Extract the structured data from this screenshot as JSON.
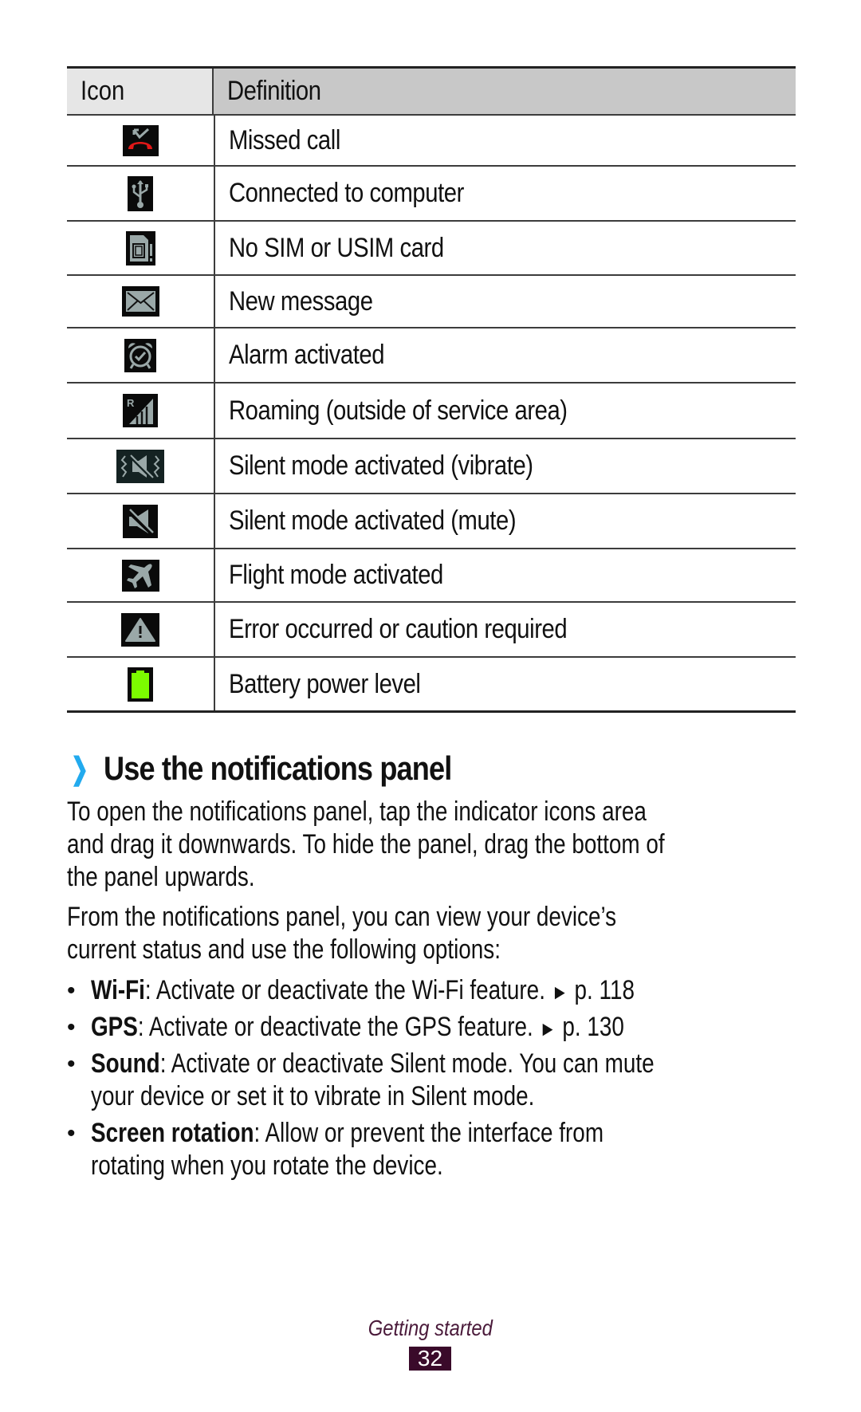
{
  "table": {
    "headers": {
      "icon": "Icon",
      "definition": "Definition"
    },
    "rows": [
      {
        "icon": "missed-call-icon",
        "definition": "Missed call"
      },
      {
        "icon": "usb-icon",
        "definition": "Connected to computer"
      },
      {
        "icon": "no-sim-icon",
        "definition": "No SIM or USIM card"
      },
      {
        "icon": "envelope-icon",
        "definition": "New message"
      },
      {
        "icon": "alarm-clock-icon",
        "definition": "Alarm activated"
      },
      {
        "icon": "roaming-signal-icon",
        "definition": "Roaming (outside of service area)"
      },
      {
        "icon": "vibrate-icon",
        "definition": "Silent mode activated (vibrate)"
      },
      {
        "icon": "mute-icon",
        "definition": "Silent mode activated (mute)"
      },
      {
        "icon": "airplane-icon",
        "definition": "Flight mode activated"
      },
      {
        "icon": "warning-icon",
        "definition": "Error occurred or caution required"
      },
      {
        "icon": "battery-icon",
        "definition": "Battery power level"
      }
    ]
  },
  "section": {
    "chevron": "❯",
    "title": "Use the notifications panel",
    "paragraph1": [
      "To open the notifications panel, tap the indicator icons area",
      "and drag it downwards. To hide the panel, drag the bottom of",
      "the panel upwards."
    ],
    "paragraph2": [
      "From the notifications panel, you can view your device’s",
      "current status and use the following options:"
    ],
    "bullets": [
      {
        "term": "Wi-Fi",
        "text": ": Activate or deactivate the Wi-Fi feature. ",
        "ref_arrow": "►",
        "ref": " p. 118",
        "continuation": ""
      },
      {
        "term": "GPS",
        "text": ": Activate or deactivate the GPS feature. ",
        "ref_arrow": "►",
        "ref": " p. 130",
        "continuation": ""
      },
      {
        "term": "Sound",
        "text": ": Activate or deactivate Silent mode. You can mute",
        "ref_arrow": "",
        "ref": "",
        "continuation": "your device or set it to vibrate in Silent mode."
      },
      {
        "term": "Screen rotation",
        "text": ": Allow or prevent the interface from",
        "ref_arrow": "",
        "ref": "",
        "continuation": "rotating when you rotate the device."
      }
    ],
    "bullet_glyph": "•"
  },
  "footer": {
    "section_name": "Getting started",
    "page_number": "32"
  },
  "colors": {
    "accent_chevron": "#22aaee",
    "footer_purple": "#3a0a2a",
    "battery_green": "#7cfc00",
    "missed_call_red": "#e01818"
  }
}
